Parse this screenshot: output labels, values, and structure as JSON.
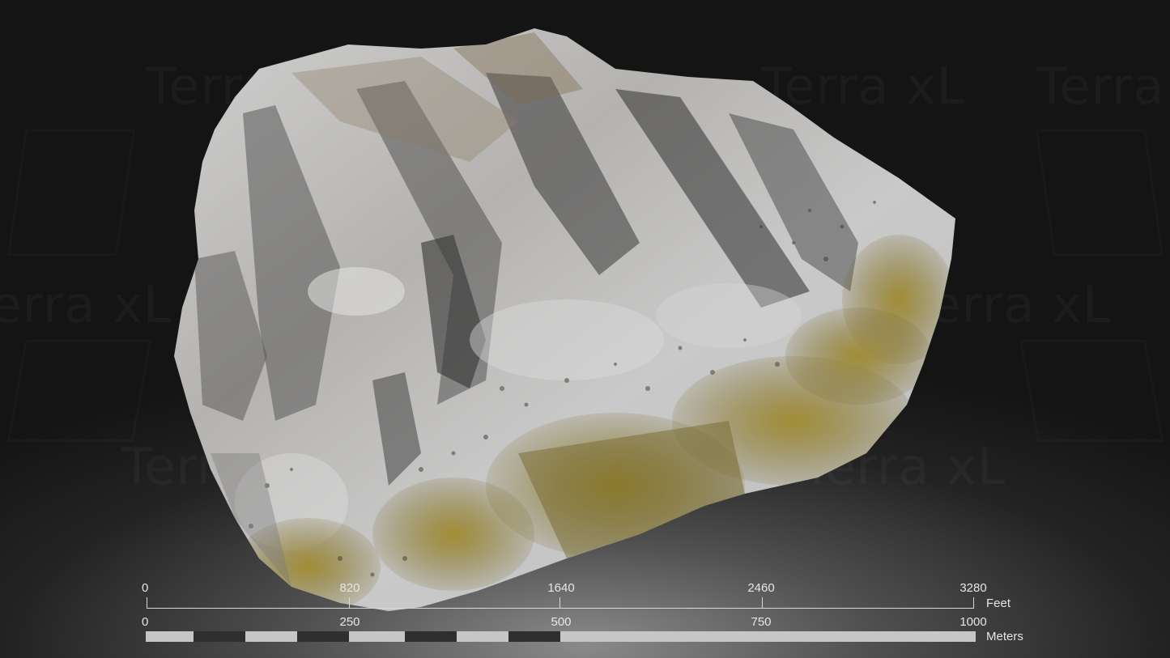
{
  "watermark_text": "Terra xL",
  "scale_bar": {
    "feet": {
      "unit_label": "Feet",
      "ticks": [
        "0",
        "820",
        "1640",
        "2460",
        "3280"
      ]
    },
    "meters": {
      "unit_label": "Meters",
      "ticks": [
        "0",
        "250",
        "500",
        "750",
        "1000"
      ]
    }
  },
  "colors": {
    "rock_light": "#c9c9c9",
    "rock_mid": "#8f8f8f",
    "rock_shadow": "#3d3d3d",
    "moss": "#8a7a2a",
    "bar_light": "#c6c6c6",
    "bar_dark": "#2f2f2f"
  }
}
